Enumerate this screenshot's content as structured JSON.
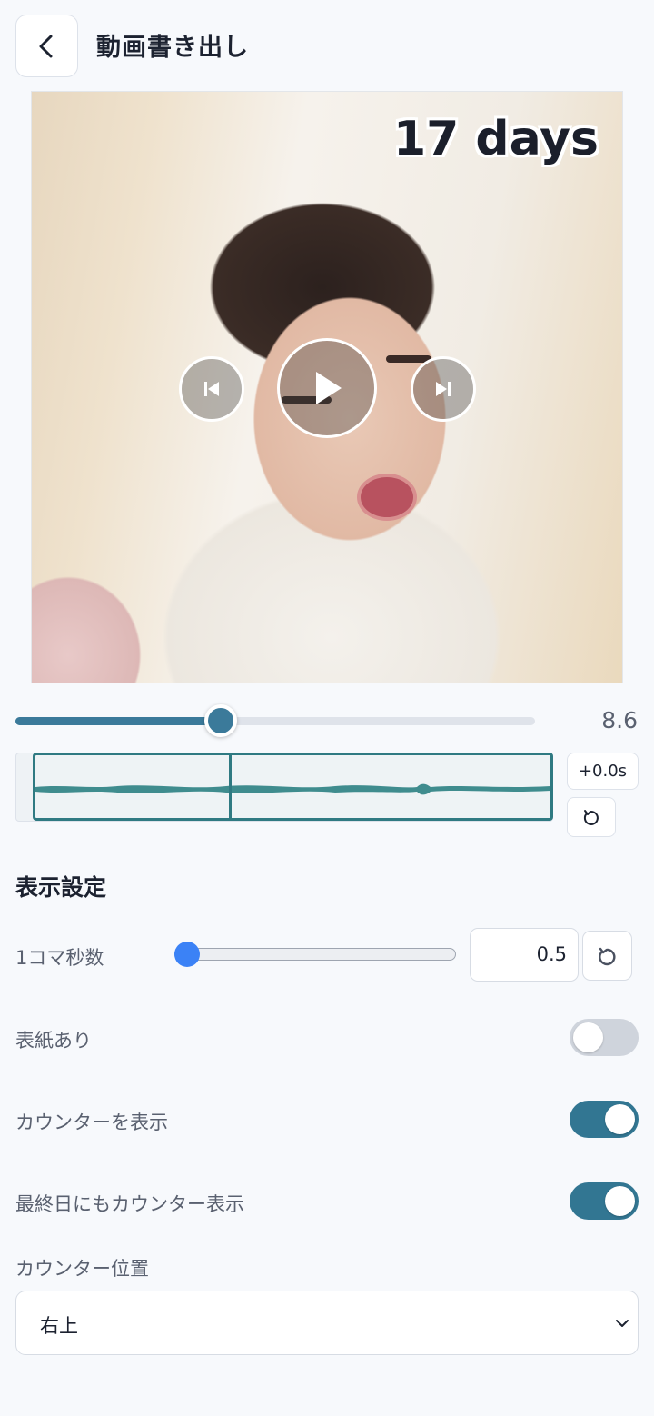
{
  "header": {
    "title": "動画書き出し"
  },
  "preview": {
    "counter_text": "17 days"
  },
  "playback": {
    "progress": 0.395,
    "time_value": "8.6"
  },
  "audio": {
    "cursor_position": 0.375,
    "offset_label": "+0.0s"
  },
  "display_settings": {
    "section_title": "表示設定",
    "frame_seconds": {
      "label": "1コマ秒数",
      "value": "0.5",
      "slider_level": 0.0
    },
    "cover": {
      "label": "表紙あり",
      "enabled": false
    },
    "show_counter": {
      "label": "カウンターを表示",
      "enabled": true
    },
    "last_day_counter": {
      "label": "最終日にもカウンター表示",
      "enabled": true
    },
    "counter_position": {
      "label": "カウンター位置",
      "selected": "右上"
    }
  },
  "colors": {
    "accent": "#327692",
    "slider_blue": "#3b82f6",
    "waveform": "#2f7a82"
  }
}
